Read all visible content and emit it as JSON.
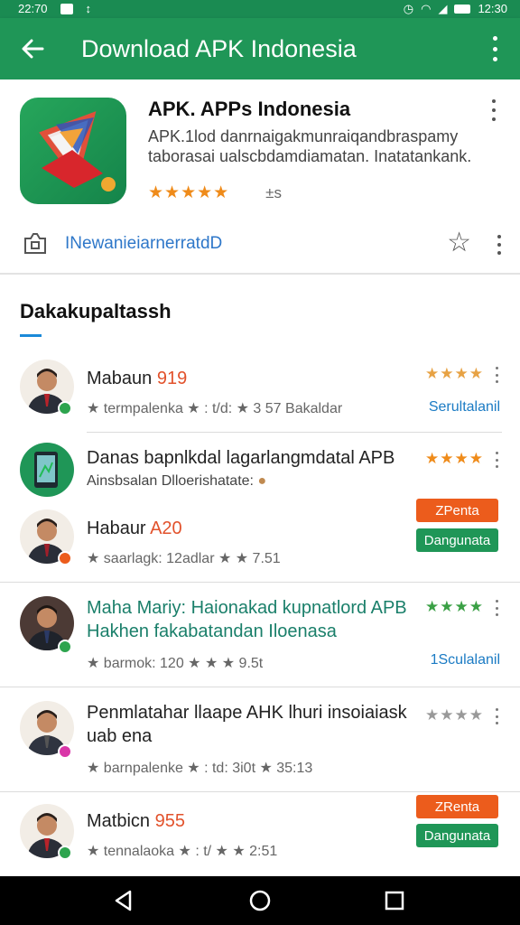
{
  "status_bar": {
    "time_left": "22:70",
    "time_right": "12:30"
  },
  "app_bar": {
    "title": "Download APK Indonesia"
  },
  "app_card": {
    "name": "APK. APPs Indonesia",
    "description": "APK.1lod danrnaigakmunraiqandbraspamy taborasai ualscbdamdiamatan. Inatatankank.",
    "stars": "★★★★★",
    "rating_extra": "±s",
    "link_text": "INewanieiarnerratdD"
  },
  "section": {
    "heading": "Dakakupaltassh"
  },
  "list": [
    {
      "title_main": "Mabaun ",
      "title_accent": "919",
      "subtitle": "★ termpalenka ★ : t/d: ★ 3  57  Bakaldar",
      "stars": "★★★★",
      "star_color": "#e7a244",
      "action_link": "Serultalanil"
    },
    {
      "title_main": "Danas bapnlkdal lagarlangmdatal APB",
      "subtitle": "Ainsbsalan Dlloerishatate: ",
      "stars": "★★★★",
      "star_color": "#ef8b1a"
    },
    {
      "title_main": "Habaur ",
      "title_accent": "A20",
      "subtitle": "★ saarlagk: 12adlar ★ ★  7.51",
      "button_primary": "ZPenta",
      "button_secondary": "Dangunata"
    },
    {
      "title_main": "Maha Mariy: Haionakad kupnatlord APB",
      "title_line2": "Hakhen fakabatandan Iloenasa",
      "subtitle": "★ barmok: 120 ★ ★  ★  9.5t",
      "stars": "★★★★",
      "star_color": "#3aa045",
      "action_link": "1Sculalanil"
    },
    {
      "title_main": "Penmlatahar llaape AHK lhuri insoiaiask",
      "title_line2": "uab ena",
      "subtitle": "★ barnpalenke ★ : td: 3i0t  ★  35:13",
      "stars": "★★★★",
      "star_color": "#999999"
    },
    {
      "title_main": "Matbicn ",
      "title_accent": "955",
      "subtitle": "★ tennalaoka ★ : t/ ★ ★  2:51",
      "button_primary": "ZRenta",
      "button_secondary": "Dangunata"
    }
  ]
}
